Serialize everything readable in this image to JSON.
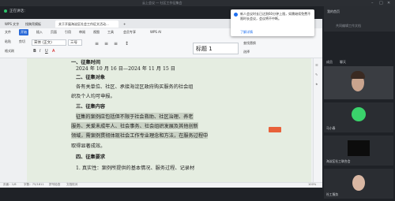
{
  "meeting": {
    "title": "云上会议 — 社区工作征集会",
    "speaking_label": "正在讲话：",
    "host_name": "我的首页",
    "host_sub": "共同编辑工作文档",
    "participants_tab": "成员",
    "participants_tab2": "聊天"
  },
  "toast": {
    "text": "新人会议时长已达到60分钟上限，如需继续免费不限时长会议，会议将不中断。",
    "link": "了解详情"
  },
  "wps": {
    "tabs": [
      "WPS 文字",
      "找稿壳模板",
      "关于开展海淀区社会工作征文活动...",
      "+"
    ],
    "menus": [
      "文件",
      "开始",
      "插入",
      "页面",
      "引用",
      "审阅",
      "视图",
      "工具",
      "会员专享",
      "WPS AI"
    ],
    "active_menu": "开始",
    "font_name": "宋体 (正文)",
    "font_size": "三号",
    "style_label": "标题 1",
    "find_replace": "查找替换",
    "select": "选择",
    "format_painter": "格式刷",
    "paste": "粘贴",
    "cut": "剪切"
  },
  "document": {
    "line_top": "一、征集时间",
    "date_range": "2024 年 10 月 16 日—2024 年 11 月 15 日",
    "h2": "二、征集对象",
    "p2a": "各有关单位、社区、承接海淀区政府购买服务的社会组",
    "p2b": "织及个人均可申报。",
    "h3": "三、征集内容",
    "p3a": "征集的案例应包括但不限于社会救助、社区治理、养老",
    "p3b": "服务、关爱未成年人、社会事务、社会组织发展及其他创新",
    "p3c": "领域，需案例贯彻体现社会工作专业理念和方法，在服务过程中",
    "p3d": "取得显著成效。",
    "h4": "四、征集要求",
    "p4a": "1. 真实性：案例所提供的基本情况、服务过程、记录材"
  },
  "status": {
    "page": "页面：1/6",
    "words": "字数：75/1811",
    "spell": "拼写检查",
    "proof": "文档校对",
    "zoom": "100%"
  },
  "participants": [
    {
      "name": "马小春"
    },
    {
      "name": "海淀区社工联合会"
    },
    {
      "name": "社工服务"
    }
  ],
  "colors": {
    "accent": "#2a6ad8",
    "meeting_bg": "#1f2227",
    "doc_page": "#e5ede1",
    "highlight": "#c9d1c4"
  }
}
